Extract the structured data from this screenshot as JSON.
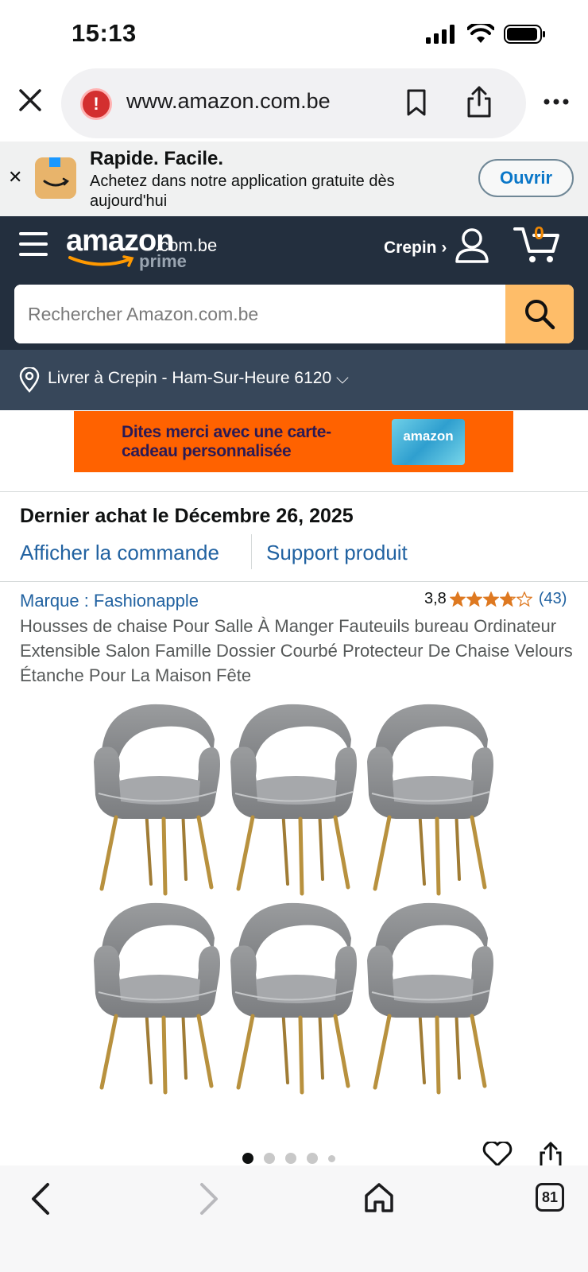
{
  "status_bar": {
    "time": "15:13"
  },
  "browser": {
    "url": "www.amazon.com.be"
  },
  "app_banner": {
    "title": "Rapide. Facile.",
    "subtitle": "Achetez dans notre application gratuite dès aujourd'hui",
    "open_label": "Ouvrir"
  },
  "header": {
    "logo_main": "amazon",
    "logo_tld": ".com.be",
    "logo_prime": "prime",
    "account_label": "Crepin ›",
    "cart_count": "0",
    "search_placeholder": "Rechercher Amazon.com.be"
  },
  "deliver": {
    "label": "Livrer à Crepin - Ham-Sur-Heure 6120 ⌵"
  },
  "promo": {
    "text": "Dites merci avec une carte-cadeau personnalisée",
    "card_label": "amazon"
  },
  "order": {
    "title": "Dernier achat le Décembre 26, 2025",
    "view_order_label": "Afficher la commande",
    "support_label": "Support produit"
  },
  "product": {
    "brand": "Marque : Fashionapple",
    "rating_value": "3,8",
    "rating_stars": 3.8,
    "rating_count": "(43)",
    "title": "Housses de chaise Pour Salle À Manger Fauteuils bureau Ordinateur Extensible Salon Famille Dossier Courbé Protecteur De Chaise Velours Étanche Pour La Maison Fête",
    "image_count": 5,
    "active_image": 1
  },
  "bottom_bar": {
    "tab_count": "81"
  },
  "colors": {
    "header_bg": "#232f3e",
    "deliver_bg": "#37475a",
    "search_button": "#febd69",
    "link": "#2162a1",
    "star": "#de7921",
    "promo_bg": "#ff6200"
  }
}
